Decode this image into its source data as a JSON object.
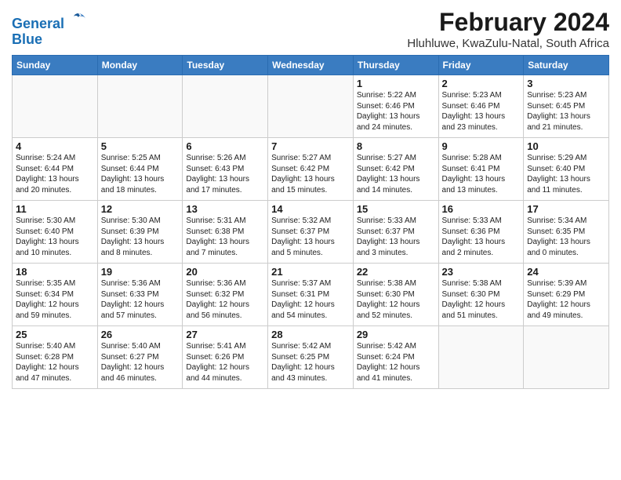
{
  "header": {
    "logo_line1": "General",
    "logo_line2": "Blue",
    "month_year": "February 2024",
    "location": "Hluhluwe, KwaZulu-Natal, South Africa"
  },
  "days_of_week": [
    "Sunday",
    "Monday",
    "Tuesday",
    "Wednesday",
    "Thursday",
    "Friday",
    "Saturday"
  ],
  "weeks": [
    [
      {
        "day": "",
        "info": ""
      },
      {
        "day": "",
        "info": ""
      },
      {
        "day": "",
        "info": ""
      },
      {
        "day": "",
        "info": ""
      },
      {
        "day": "1",
        "info": "Sunrise: 5:22 AM\nSunset: 6:46 PM\nDaylight: 13 hours\nand 24 minutes."
      },
      {
        "day": "2",
        "info": "Sunrise: 5:23 AM\nSunset: 6:46 PM\nDaylight: 13 hours\nand 23 minutes."
      },
      {
        "day": "3",
        "info": "Sunrise: 5:23 AM\nSunset: 6:45 PM\nDaylight: 13 hours\nand 21 minutes."
      }
    ],
    [
      {
        "day": "4",
        "info": "Sunrise: 5:24 AM\nSunset: 6:44 PM\nDaylight: 13 hours\nand 20 minutes."
      },
      {
        "day": "5",
        "info": "Sunrise: 5:25 AM\nSunset: 6:44 PM\nDaylight: 13 hours\nand 18 minutes."
      },
      {
        "day": "6",
        "info": "Sunrise: 5:26 AM\nSunset: 6:43 PM\nDaylight: 13 hours\nand 17 minutes."
      },
      {
        "day": "7",
        "info": "Sunrise: 5:27 AM\nSunset: 6:42 PM\nDaylight: 13 hours\nand 15 minutes."
      },
      {
        "day": "8",
        "info": "Sunrise: 5:27 AM\nSunset: 6:42 PM\nDaylight: 13 hours\nand 14 minutes."
      },
      {
        "day": "9",
        "info": "Sunrise: 5:28 AM\nSunset: 6:41 PM\nDaylight: 13 hours\nand 13 minutes."
      },
      {
        "day": "10",
        "info": "Sunrise: 5:29 AM\nSunset: 6:40 PM\nDaylight: 13 hours\nand 11 minutes."
      }
    ],
    [
      {
        "day": "11",
        "info": "Sunrise: 5:30 AM\nSunset: 6:40 PM\nDaylight: 13 hours\nand 10 minutes."
      },
      {
        "day": "12",
        "info": "Sunrise: 5:30 AM\nSunset: 6:39 PM\nDaylight: 13 hours\nand 8 minutes."
      },
      {
        "day": "13",
        "info": "Sunrise: 5:31 AM\nSunset: 6:38 PM\nDaylight: 13 hours\nand 7 minutes."
      },
      {
        "day": "14",
        "info": "Sunrise: 5:32 AM\nSunset: 6:37 PM\nDaylight: 13 hours\nand 5 minutes."
      },
      {
        "day": "15",
        "info": "Sunrise: 5:33 AM\nSunset: 6:37 PM\nDaylight: 13 hours\nand 3 minutes."
      },
      {
        "day": "16",
        "info": "Sunrise: 5:33 AM\nSunset: 6:36 PM\nDaylight: 13 hours\nand 2 minutes."
      },
      {
        "day": "17",
        "info": "Sunrise: 5:34 AM\nSunset: 6:35 PM\nDaylight: 13 hours\nand 0 minutes."
      }
    ],
    [
      {
        "day": "18",
        "info": "Sunrise: 5:35 AM\nSunset: 6:34 PM\nDaylight: 12 hours\nand 59 minutes."
      },
      {
        "day": "19",
        "info": "Sunrise: 5:36 AM\nSunset: 6:33 PM\nDaylight: 12 hours\nand 57 minutes."
      },
      {
        "day": "20",
        "info": "Sunrise: 5:36 AM\nSunset: 6:32 PM\nDaylight: 12 hours\nand 56 minutes."
      },
      {
        "day": "21",
        "info": "Sunrise: 5:37 AM\nSunset: 6:31 PM\nDaylight: 12 hours\nand 54 minutes."
      },
      {
        "day": "22",
        "info": "Sunrise: 5:38 AM\nSunset: 6:30 PM\nDaylight: 12 hours\nand 52 minutes."
      },
      {
        "day": "23",
        "info": "Sunrise: 5:38 AM\nSunset: 6:30 PM\nDaylight: 12 hours\nand 51 minutes."
      },
      {
        "day": "24",
        "info": "Sunrise: 5:39 AM\nSunset: 6:29 PM\nDaylight: 12 hours\nand 49 minutes."
      }
    ],
    [
      {
        "day": "25",
        "info": "Sunrise: 5:40 AM\nSunset: 6:28 PM\nDaylight: 12 hours\nand 47 minutes."
      },
      {
        "day": "26",
        "info": "Sunrise: 5:40 AM\nSunset: 6:27 PM\nDaylight: 12 hours\nand 46 minutes."
      },
      {
        "day": "27",
        "info": "Sunrise: 5:41 AM\nSunset: 6:26 PM\nDaylight: 12 hours\nand 44 minutes."
      },
      {
        "day": "28",
        "info": "Sunrise: 5:42 AM\nSunset: 6:25 PM\nDaylight: 12 hours\nand 43 minutes."
      },
      {
        "day": "29",
        "info": "Sunrise: 5:42 AM\nSunset: 6:24 PM\nDaylight: 12 hours\nand 41 minutes."
      },
      {
        "day": "",
        "info": ""
      },
      {
        "day": "",
        "info": ""
      }
    ]
  ]
}
